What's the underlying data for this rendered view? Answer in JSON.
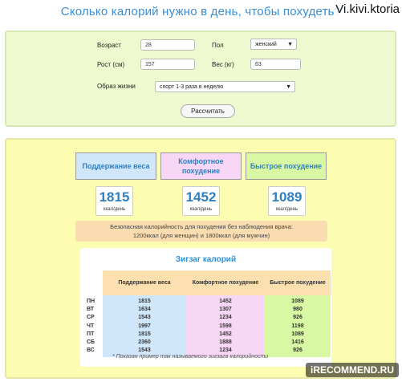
{
  "page": {
    "title": "Сколько калорий нужно в день, чтобы похудеть?",
    "watermark_top": "Vi.kivi.ktoria",
    "watermark_bottom": "iRECOMMEND.RU"
  },
  "form": {
    "age_label": "Возраст",
    "age_value": "28",
    "sex_label": "Пол",
    "sex_value": "женский",
    "height_label": "Рост  (см)",
    "height_value": "157",
    "weight_label": "Вес  (кг)",
    "weight_value": "63",
    "lifestyle_label": "Образ жизни",
    "lifestyle_value": "спорт 1-3 раза в неделю",
    "calc_button": "Рассчитать"
  },
  "results": {
    "categories": [
      {
        "label": "Поддержание веса",
        "value": "1815",
        "unit": "ккал/день",
        "color": "#cfe6fb"
      },
      {
        "label": "Комфортное похудение",
        "value": "1452",
        "unit": "ккал/день",
        "color": "#f8d6f6"
      },
      {
        "label": "Быстрое похудение",
        "value": "1089",
        "unit": "ккал/день",
        "color": "#d8f8a4"
      }
    ],
    "note_line1": "Безопасная калорийность для похудения без наблюдения врача:",
    "note_line2": "1200ккал (для женщин) и 1800ккал (для мужчин)"
  },
  "zigzag": {
    "title": "Зигзаг калорий",
    "days": [
      "ПН",
      "ВТ",
      "СР",
      "ЧТ",
      "ПТ",
      "СБ",
      "ВС"
    ],
    "headers": [
      "Поддержание веса",
      "Комфортное похудение",
      "Быстрое похудение"
    ],
    "maintain": [
      "1815",
      "1634",
      "1543",
      "1997",
      "1815",
      "2360",
      "1543"
    ],
    "comfort": [
      "1452",
      "1307",
      "1234",
      "1598",
      "1452",
      "1888",
      "1234"
    ],
    "fast": [
      "1089",
      "980",
      "926",
      "1198",
      "1089",
      "1416",
      "926"
    ],
    "footnote": "* Показан пример так называемого зигзага калорийности",
    "colors": {
      "maintain": "#cfe6fb",
      "comfort": "#f8d6f6",
      "fast": "#d8f8a4"
    }
  }
}
